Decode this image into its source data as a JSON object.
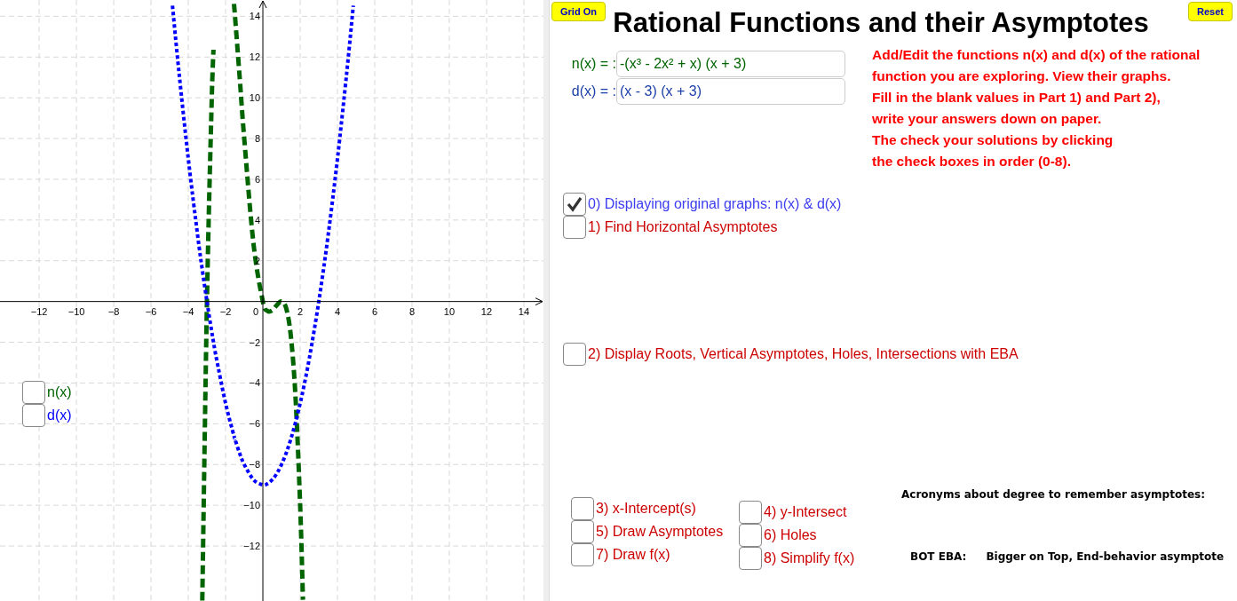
{
  "graph": {
    "chart_data": {
      "type": "line",
      "x": [
        -4.85,
        -4.5,
        -4,
        -3.5,
        -3.25,
        -3,
        -2.75,
        -2.65,
        -2.5,
        -2,
        -1.55,
        -1.5,
        -1.25,
        -1,
        -0.5,
        0,
        0.25,
        0.5,
        0.75,
        1,
        1.25,
        1.5,
        1.75,
        2,
        2.15,
        2.5,
        3,
        3.5,
        4,
        4.5,
        4.85
      ],
      "series": [
        {
          "name": "n(x)",
          "color": "#006400",
          "line_style": "dashed",
          "values": [
            null,
            null,
            null,
            null,
            -14.68,
            0,
            9.67,
            12.36,
            null,
            null,
            14.61,
            14.06,
            11.07,
            8,
            2.81,
            0,
            -0.46,
            -0.44,
            -0.18,
            0,
            -0.33,
            -1.69,
            -4.68,
            -10,
            -14.64,
            null,
            null,
            null,
            null,
            null,
            null
          ]
        },
        {
          "name": "d(x)",
          "color": "#0000ff",
          "line_style": "dotted",
          "values": [
            14.52,
            11.25,
            7,
            3.25,
            1.56,
            0,
            -1.44,
            -1.98,
            -2.75,
            -5,
            -6.6,
            -6.75,
            -7.44,
            -8,
            -8.75,
            -9,
            -8.94,
            -8.75,
            -8.44,
            -8,
            -7.44,
            -6.75,
            -5.94,
            -5,
            -4.38,
            -2.75,
            0,
            3.25,
            7,
            11.25,
            14.52
          ]
        }
      ],
      "grid": true,
      "xlim": [
        -14.1,
        15.05
      ],
      "ylim": [
        -14.7,
        14.8
      ],
      "xticks": [
        {
          "value": -12,
          "label": "−12"
        },
        {
          "value": -10,
          "label": "−10"
        },
        {
          "value": -8,
          "label": "−8"
        },
        {
          "value": -6,
          "label": "−6"
        },
        {
          "value": -4,
          "label": "−4"
        },
        {
          "value": -2,
          "label": "−2"
        },
        {
          "value": 2,
          "label": "2"
        },
        {
          "value": 4,
          "label": "4"
        },
        {
          "value": 6,
          "label": "6"
        },
        {
          "value": 8,
          "label": "8"
        },
        {
          "value": 10,
          "label": "10"
        },
        {
          "value": 12,
          "label": "12"
        },
        {
          "value": 14,
          "label": "14"
        }
      ],
      "yticks": [
        {
          "value": -12,
          "label": "−12"
        },
        {
          "value": -10,
          "label": "−10"
        },
        {
          "value": -8,
          "label": "−8"
        },
        {
          "value": -6,
          "label": "−6"
        },
        {
          "value": -4,
          "label": "−4"
        },
        {
          "value": -2,
          "label": "−2"
        },
        {
          "value": 2,
          "label": "2"
        },
        {
          "value": 4,
          "label": "4"
        },
        {
          "value": 6,
          "label": "6"
        },
        {
          "value": 8,
          "label": "8"
        },
        {
          "value": 10,
          "label": "10"
        },
        {
          "value": 12,
          "label": "12"
        },
        {
          "value": 14,
          "label": "14"
        }
      ]
    },
    "origin_label": "0",
    "toggles": [
      {
        "checked": false
      },
      {
        "checked": false
      }
    ]
  },
  "grid_button": "Grid On",
  "title": "Rational Functions and their Asymptotes",
  "reset_button": "Reset",
  "functions": [
    {
      "label": "n(x) = :",
      "value": "-(x³ - 2x² + x) (x + 3)",
      "color": "#006400"
    },
    {
      "label": "d(x) = :",
      "value": "(x - 3) (x + 3)",
      "color": "#1c3fa8"
    }
  ],
  "instructions": [
    "Add/Edit the functions n(x) and d(x) of the rational",
    "function you are exploring. View their graphs.",
    "Fill in the blank values in Part 1) and Part 2),",
    "write your answers down on paper.",
    "The check your solutions by clicking",
    "the check boxes in order (0-8)."
  ],
  "steps": [
    {
      "label": "0) Displaying original graphs: n(x) & d(x)",
      "checked": true,
      "color": "#3c3cf0"
    },
    {
      "label": "1) Find Horizontal Asymptotes",
      "checked": false,
      "color": "#cc0000"
    },
    {
      "label": "2) Display Roots, Vertical Asymptotes, Holes, Intersections with EBA",
      "checked": false,
      "color": "#cc0000"
    }
  ],
  "step_columns": [
    [
      {
        "label": "3) x-Intercept(s)",
        "checked": false,
        "color": "#cc0000"
      },
      {
        "label": "5) Draw Asymptotes",
        "checked": false,
        "color": "#cc0000"
      },
      {
        "label": "7) Draw f(x)",
        "checked": false,
        "color": "#cc0000"
      }
    ],
    [
      {
        "label": "4) y-Intersect",
        "checked": false,
        "color": "#cc0000"
      },
      {
        "label": "6) Holes",
        "checked": false,
        "color": "#cc0000"
      },
      {
        "label": "8) Simplify f(x)",
        "checked": false,
        "color": "#cc0000"
      }
    ]
  ],
  "acronyms": {
    "heading": "Acronyms about degree to remember asymptotes:",
    "term": "BOT EBA:",
    "meaning": "Bigger on Top, End-behavior asymptote"
  }
}
